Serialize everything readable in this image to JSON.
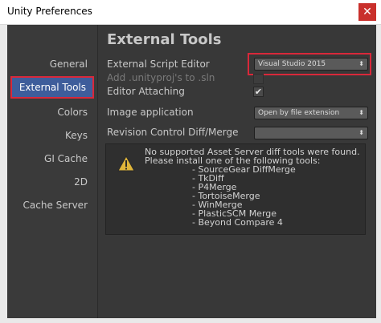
{
  "window": {
    "title": "Unity Preferences",
    "close_glyph": "✕"
  },
  "sidebar": {
    "items": [
      {
        "label": "General"
      },
      {
        "label": "External Tools"
      },
      {
        "label": "Colors"
      },
      {
        "label": "Keys"
      },
      {
        "label": "GI Cache"
      },
      {
        "label": "2D"
      },
      {
        "label": "Cache Server"
      }
    ],
    "selected": "External Tools",
    "selected_color": "#3e5d9b",
    "annotation_color": "#d9283a"
  },
  "main": {
    "title": "External Tools",
    "rows": {
      "script_editor": {
        "label": "External Script Editor",
        "value": "Visual Studio 2015"
      },
      "add_unityproj": {
        "label": "Add .unityproj's to .sln",
        "checked": false
      },
      "editor_attaching": {
        "label": "Editor Attaching",
        "checked": true
      },
      "image_application": {
        "label": "Image application",
        "value": "Open by file extension"
      },
      "revision_control": {
        "label": "Revision Control Diff/Merge",
        "value": ""
      }
    },
    "dropdown_arrow": "⬍",
    "check_glyph": "✔",
    "info": {
      "icon": "warning-icon",
      "lines": [
        "No supported Asset Server diff tools were found.",
        "Please install one of the following tools:",
        "- SourceGear DiffMerge",
        "- TkDiff",
        "- P4Merge",
        "- TortoiseMerge",
        "- WinMerge",
        "- PlasticSCM Merge",
        "- Beyond Compare 4"
      ]
    }
  }
}
